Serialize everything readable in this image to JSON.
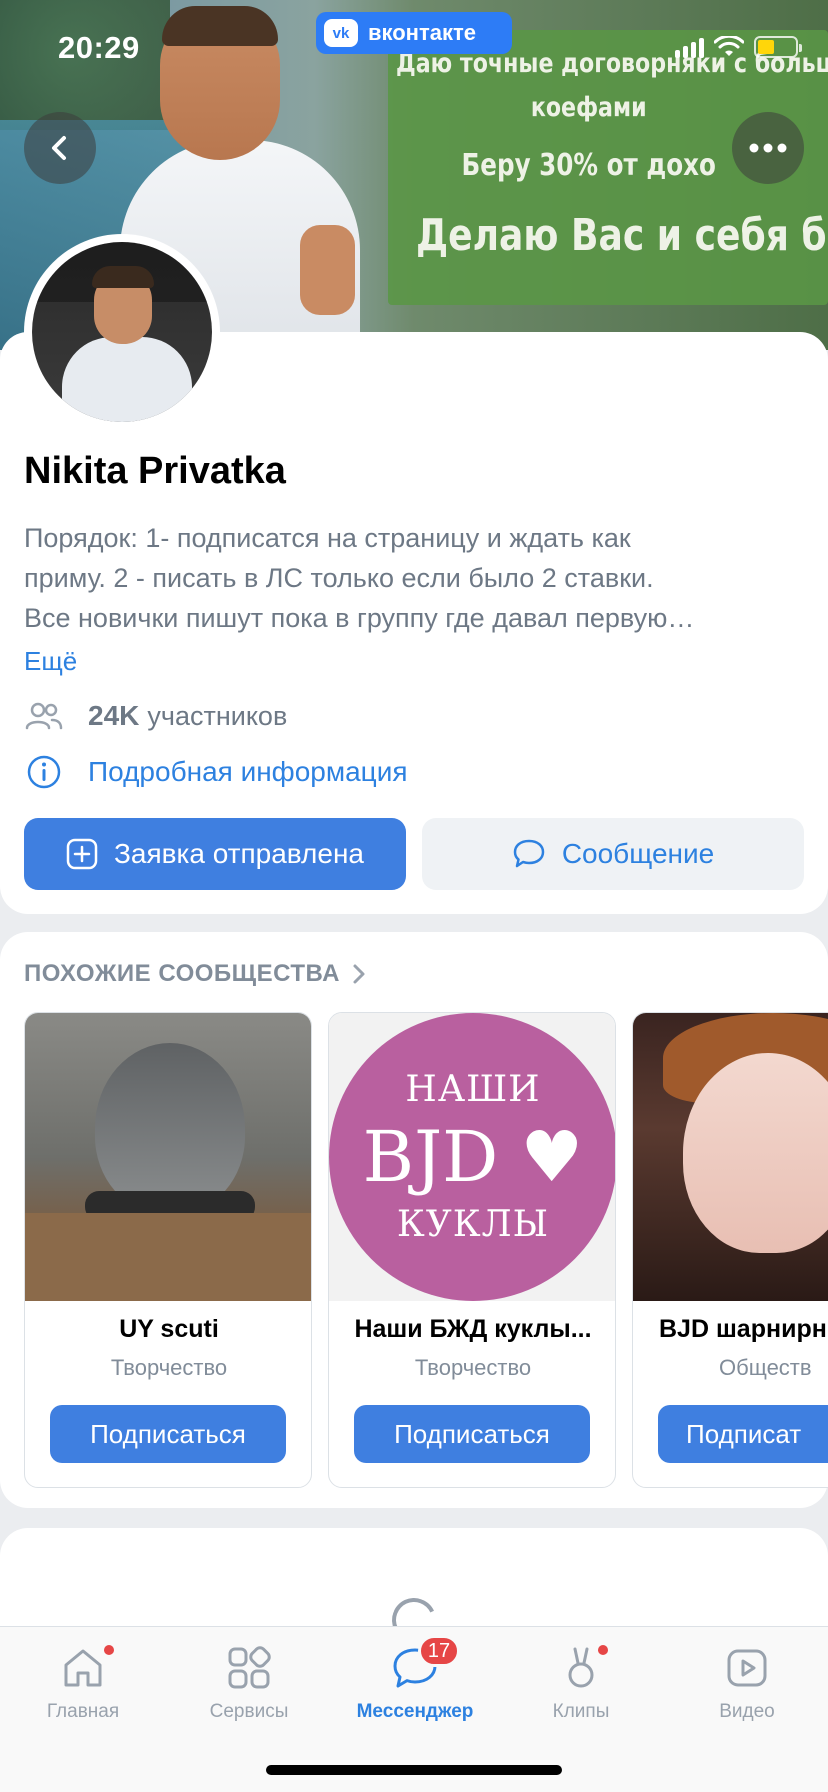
{
  "status_bar": {
    "time": "20:29",
    "app_pill": "вконтакте",
    "app_pill_logo": "vk"
  },
  "cover": {
    "promo_lines": [
      "Даю точные договорняки с больш",
      "коефами",
      "Беру 30% от дохо",
      "Делаю Вас и себя бога"
    ]
  },
  "profile": {
    "name": "Nikita Privatka",
    "description_lines": [
      "Порядок:  1- подписатся на страницу и ждать как",
      "приму. 2 - писать в ЛС только если было 2 ставки.",
      "Все новички пишут пока в группу где давал первую…"
    ],
    "more_label": "Ещё",
    "members_count": "24K",
    "members_label": "участников",
    "details_label": "Подробная информация",
    "primary_button": "Заявка отправлена",
    "secondary_button": "Сообщение"
  },
  "similar": {
    "title": "ПОХОЖИЕ СООБЩЕСТВА",
    "items": [
      {
        "name": "UY scuti",
        "category": "Творчество",
        "button": "Подписаться"
      },
      {
        "name": "Наши БЖД куклы...",
        "category": "Творчество",
        "button": "Подписаться",
        "image_text": [
          "НАШИ",
          "BJD ♥",
          "КУКЛЫ"
        ]
      },
      {
        "name": "BJD шарнирн",
        "category": "Обществ",
        "button": "Подписат"
      }
    ]
  },
  "tabbar": {
    "tabs": [
      {
        "label": "Главная",
        "icon": "home-icon",
        "dot": true
      },
      {
        "label": "Сервисы",
        "icon": "services-icon",
        "dot": false
      },
      {
        "label": "Мессенджер",
        "icon": "chat-icon",
        "badge": "17",
        "active": true
      },
      {
        "label": "Клипы",
        "icon": "clips-icon",
        "dot": true
      },
      {
        "label": "Видео",
        "icon": "video-icon",
        "dot": false
      }
    ]
  },
  "colors": {
    "accent": "#2d81e0",
    "primary_button": "#3f7fe0",
    "badge": "#e64646",
    "muted_text": "#6d7885"
  }
}
